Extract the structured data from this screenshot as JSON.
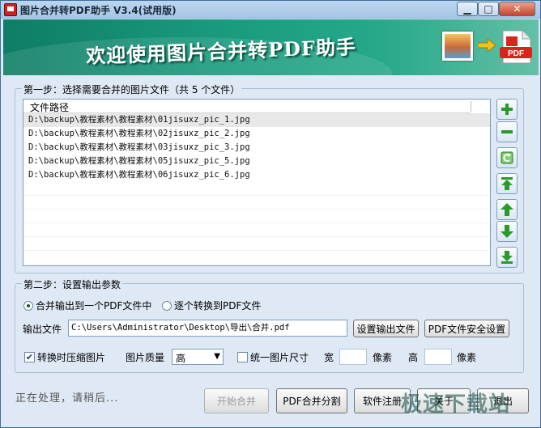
{
  "window": {
    "title": "图片合并转PDF助手 V3.4(试用版)",
    "minimize_label": "▁",
    "maximize_label": "□",
    "close_label": "✕"
  },
  "banner": {
    "title": "欢迎使用图片合并转PDF助手",
    "pdf_badge": "PDF"
  },
  "step1": {
    "label": "第一步：选择需要合并的图片文件（共 5 个文件）",
    "column_header": "文件路径",
    "files": [
      "D:\\backup\\教程素材\\教程素材\\01jisuxz_pic_1.jpg",
      "D:\\backup\\教程素材\\教程素材\\02jisuxz_pic_2.jpg",
      "D:\\backup\\教程素材\\教程素材\\03jisuxz_pic_3.jpg",
      "D:\\backup\\教程素材\\教程素材\\05jisuxz_pic_5.jpg",
      "D:\\backup\\教程素材\\教程素材\\06jisuxz_pic_6.jpg"
    ],
    "side_buttons": [
      "add-icon",
      "remove-icon",
      "clear-icon",
      "move-top-icon",
      "move-up-icon",
      "move-down-icon",
      "move-bottom-icon"
    ]
  },
  "step2": {
    "label": "第二步：设置输出参数",
    "radio_merge": "合并输出到一个PDF文件中",
    "radio_each": "逐个转换到PDF文件",
    "output_label": "输出文件",
    "output_value": "C:\\Users\\Administrator\\Desktop\\导出\\合并.pdf",
    "set_output_button": "设置输出文件",
    "security_button": "PDF文件安全设置",
    "compress_label": "转换时压缩图片",
    "quality_label": "图片质量",
    "quality_value": "高",
    "unify_label": "统一图片尺寸",
    "width_label": "宽",
    "width_unit": "像素",
    "height_label": "高",
    "height_unit": "像素"
  },
  "footer": {
    "status": "正在处理，请稍后...",
    "start_button": "开始合并",
    "split_button": "PDF合并分割",
    "register_button": "软件注册",
    "about_button": "关于",
    "exit_button": "退出",
    "watermark": "极速下载站"
  },
  "colors": {
    "banner": "#199a7e",
    "accent_green": "#2a9a2a",
    "window_bg": "#dfe9f5"
  }
}
